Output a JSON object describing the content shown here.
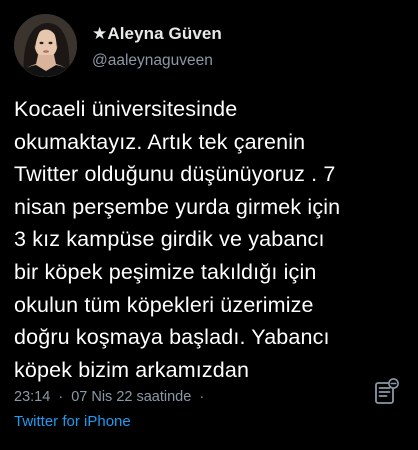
{
  "author": {
    "display_name": "★Aleyna Güven",
    "handle": "@aaleynaguveen"
  },
  "tweet": {
    "lines": [
      "Kocaeli üniversitesinde",
      "okumaktayız. Artık tek çarenin",
      "Twitter olduğunu düşünüyoruz . 7",
      "nisan perşembe yurda girmek için",
      "3 kız kampüse girdik ve yabancı",
      "bir köpek peşimize takıldığı için",
      "okulun tüm köpekleri üzerimize",
      "doğru koşmaya başladı. Yabancı",
      "köpek bizim arkamızdan"
    ]
  },
  "meta": {
    "time": "23:14",
    "separator": "·",
    "date": "07 Nis 22 saatinde",
    "separator_end": "·",
    "source": "Twitter for iPhone"
  },
  "icons": {
    "avatar": "profile-photo",
    "action": "notes-icon"
  },
  "colors": {
    "background": "#000000",
    "text": "#ffffff",
    "secondary": "#8b98a5",
    "link": "#1d9bf0"
  }
}
